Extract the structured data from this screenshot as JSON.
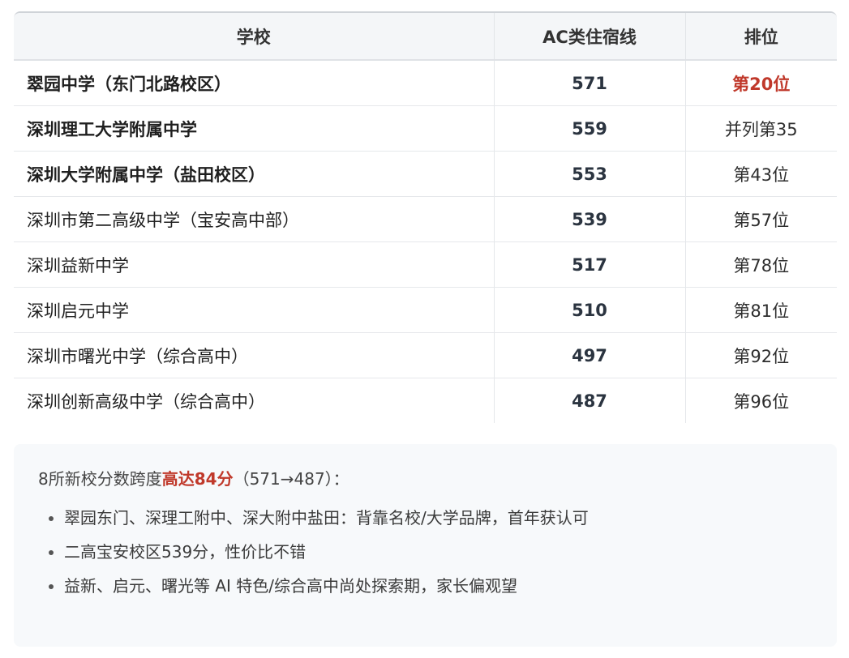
{
  "table": {
    "headers": [
      "学校",
      "AC类住宿线",
      "排位"
    ],
    "rows": [
      {
        "school": "翠园中学（东门北路校区）",
        "score": "571",
        "rank": "第20位",
        "bold": true,
        "highlight": true
      },
      {
        "school": "深圳理工大学附属中学",
        "score": "559",
        "rank": "并列第35",
        "bold": true,
        "highlight": false
      },
      {
        "school": "深圳大学附属中学（盐田校区）",
        "score": "553",
        "rank": "第43位",
        "bold": true,
        "highlight": false
      },
      {
        "school": "深圳市第二高级中学（宝安高中部）",
        "score": "539",
        "rank": "第57位",
        "bold": false,
        "highlight": false
      },
      {
        "school": "深圳益新中学",
        "score": "517",
        "rank": "第78位",
        "bold": false,
        "highlight": false
      },
      {
        "school": "深圳启元中学",
        "score": "510",
        "rank": "第81位",
        "bold": false,
        "highlight": false
      },
      {
        "school": "深圳市曙光中学（综合高中）",
        "score": "497",
        "rank": "第92位",
        "bold": false,
        "highlight": false
      },
      {
        "school": "深圳创新高级中学（综合高中）",
        "score": "487",
        "rank": "第96位",
        "bold": false,
        "highlight": false
      }
    ]
  },
  "note": {
    "summary_prefix": "8所新校分数跨度",
    "summary_highlight": "高达84分",
    "summary_suffix": "（571→487）：",
    "bullets": [
      "翠园东门、深理工附中、深大附中盐田：背靠名校/大学品牌，首年获认可",
      "二高宝安校区539分，性价比不错",
      "益新、启元、曙光等 AI 特色/综合高中尚处探索期，家长偏观望"
    ]
  },
  "colors": {
    "highlight": "#c0392b",
    "header_bg": "#f4f6f8",
    "note_bg": "#f7f9fb"
  }
}
